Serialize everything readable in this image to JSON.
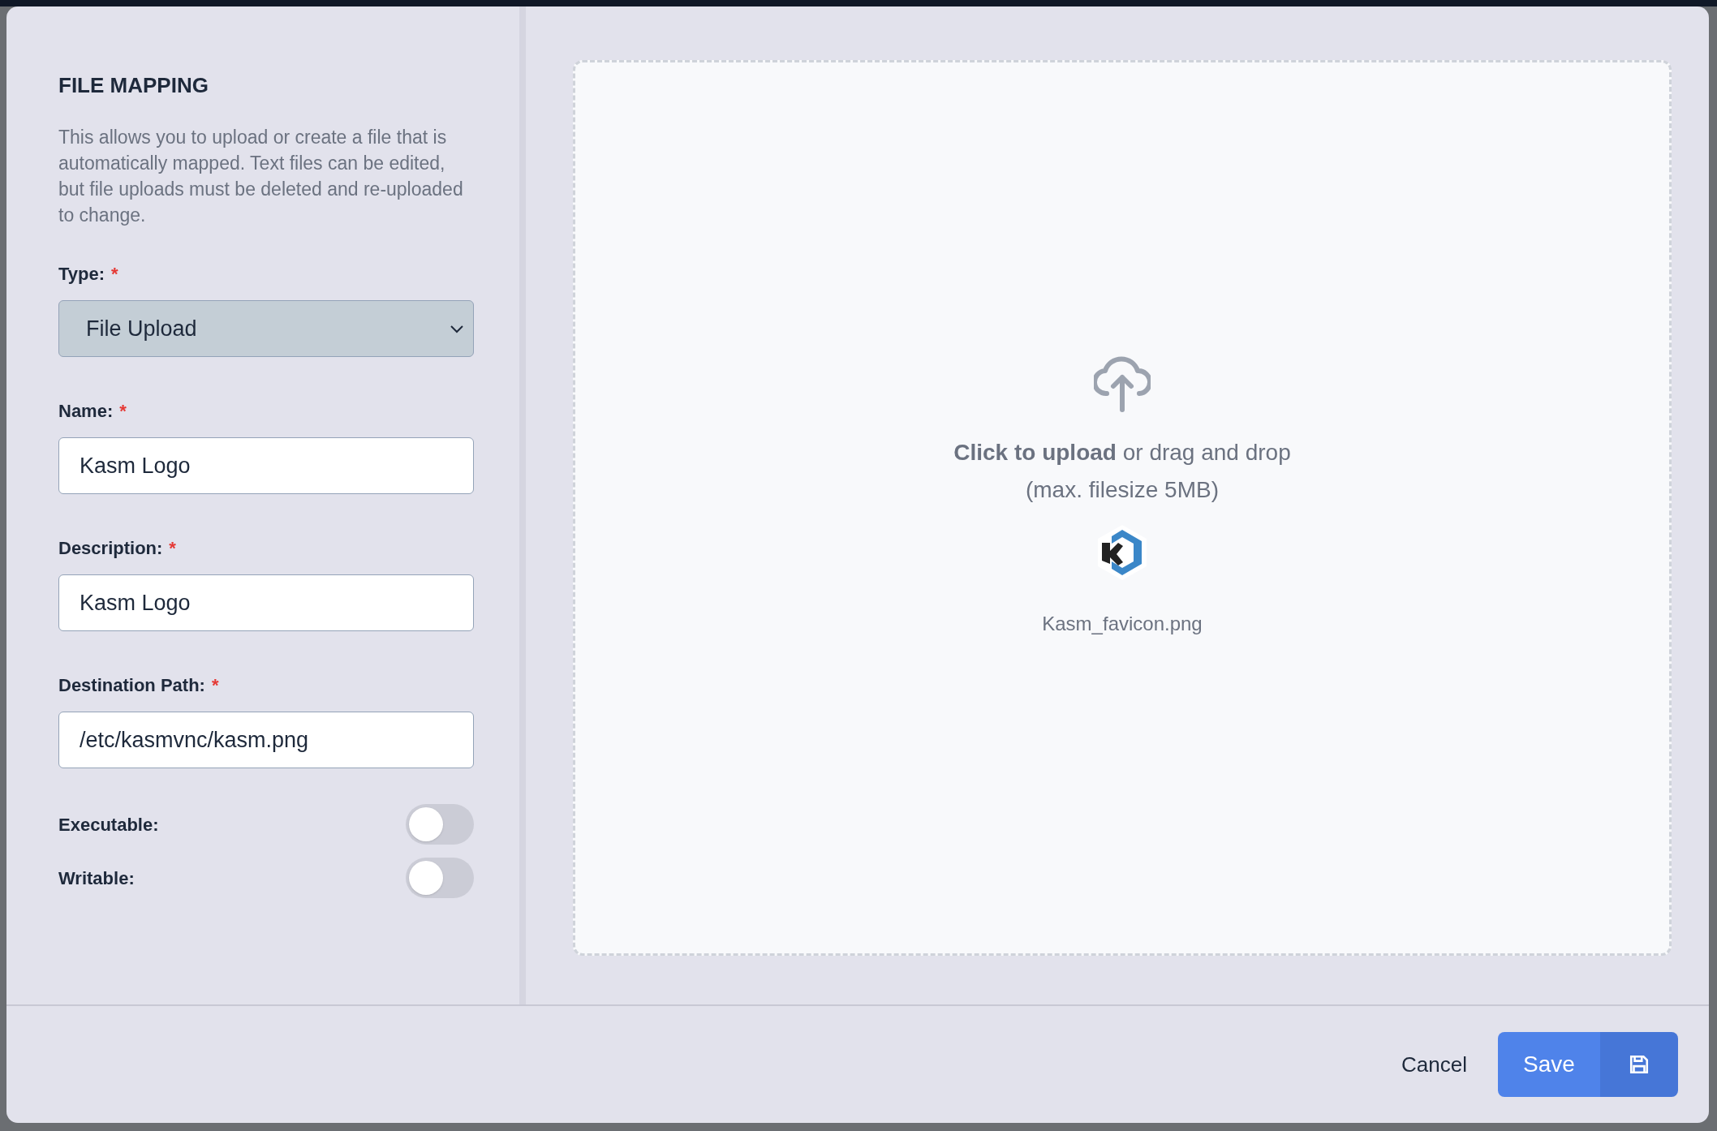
{
  "panel": {
    "title": "FILE MAPPING",
    "description": "This allows you to upload or create a file that is automatically mapped. Text files can be edited, but file uploads must be deleted and re-uploaded to change."
  },
  "fields": [
    {
      "kind": "select",
      "label": "Type:",
      "required_mark": "*",
      "value": "File Upload"
    },
    {
      "kind": "text",
      "label": "Name:",
      "required_mark": "*",
      "value": "Kasm Logo"
    },
    {
      "kind": "text",
      "label": "Description:",
      "required_mark": "*",
      "value": "Kasm Logo"
    },
    {
      "kind": "text",
      "label": "Destination Path:",
      "required_mark": "*",
      "value": "/etc/kasmvnc/kasm.png"
    }
  ],
  "toggles": [
    {
      "label": "Executable:",
      "on": false
    },
    {
      "label": "Writable:",
      "on": false
    }
  ],
  "dropzone": {
    "prompt": "**Click to upload** or drag and drop",
    "limit": "(max. filesize 5MB)",
    "file_name": "Kasm_favicon.png"
  },
  "footer": {
    "cancel": "Cancel",
    "save": "Save"
  }
}
